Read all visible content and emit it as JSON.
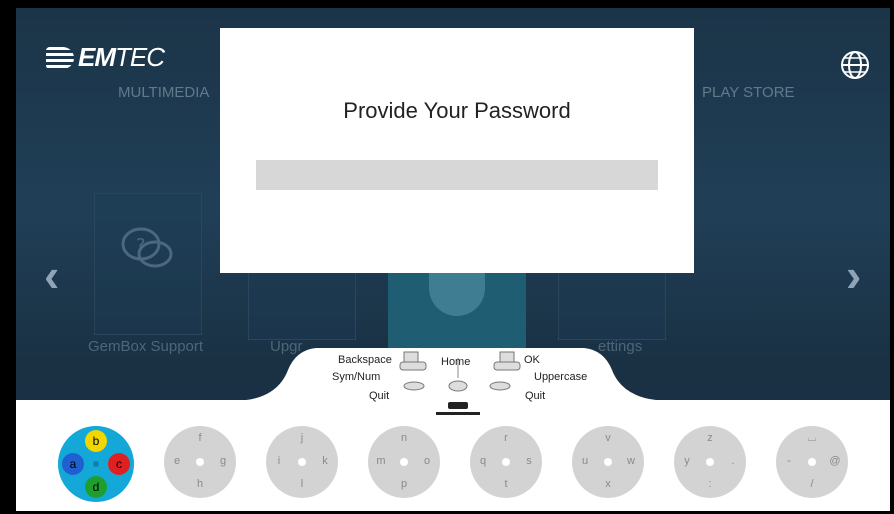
{
  "brand": {
    "logo_bold": "EM",
    "logo_light": "TEC"
  },
  "top_nav": {
    "multimedia": "MULTIMEDIA",
    "play_store": "PLAY STORE"
  },
  "tiles": {
    "support": "GemBox Support",
    "upgrade": "Upgr",
    "settings": "ettings"
  },
  "dialog": {
    "title": "Provide Your Password",
    "password_value": ""
  },
  "controller_guide": {
    "backspace": "Backspace",
    "sym_num": "Sym/Num",
    "home": "Home",
    "ok": "OK",
    "uppercase": "Uppercase",
    "quit_left": "Quit",
    "quit_right": "Quit",
    "lb": "LB",
    "lt": "LT",
    "rb": "RB",
    "rt": "RT"
  },
  "keyboard": {
    "active": {
      "top": "b",
      "left": "a",
      "right": "c",
      "bottom": "d"
    },
    "wheels": [
      {
        "top": "f",
        "left": "e",
        "right": "g",
        "bottom": "h"
      },
      {
        "top": "j",
        "left": "i",
        "right": "k",
        "bottom": "l"
      },
      {
        "top": "n",
        "left": "m",
        "right": "o",
        "bottom": "p"
      },
      {
        "top": "r",
        "left": "q",
        "right": "s",
        "bottom": "t"
      },
      {
        "top": "v",
        "left": "u",
        "right": "w",
        "bottom": "x"
      },
      {
        "top": "z",
        "left": "y",
        "right": ".",
        "bottom": ":"
      },
      {
        "top": "⌴",
        "left": "-",
        "right": "@",
        "bottom": "/"
      }
    ]
  },
  "colors": {
    "active_wheel": "#14a8d9",
    "btn_yellow": "#f2d600",
    "btn_blue": "#1f5fd1",
    "btn_red": "#e02020",
    "btn_green": "#1e9e2f"
  }
}
